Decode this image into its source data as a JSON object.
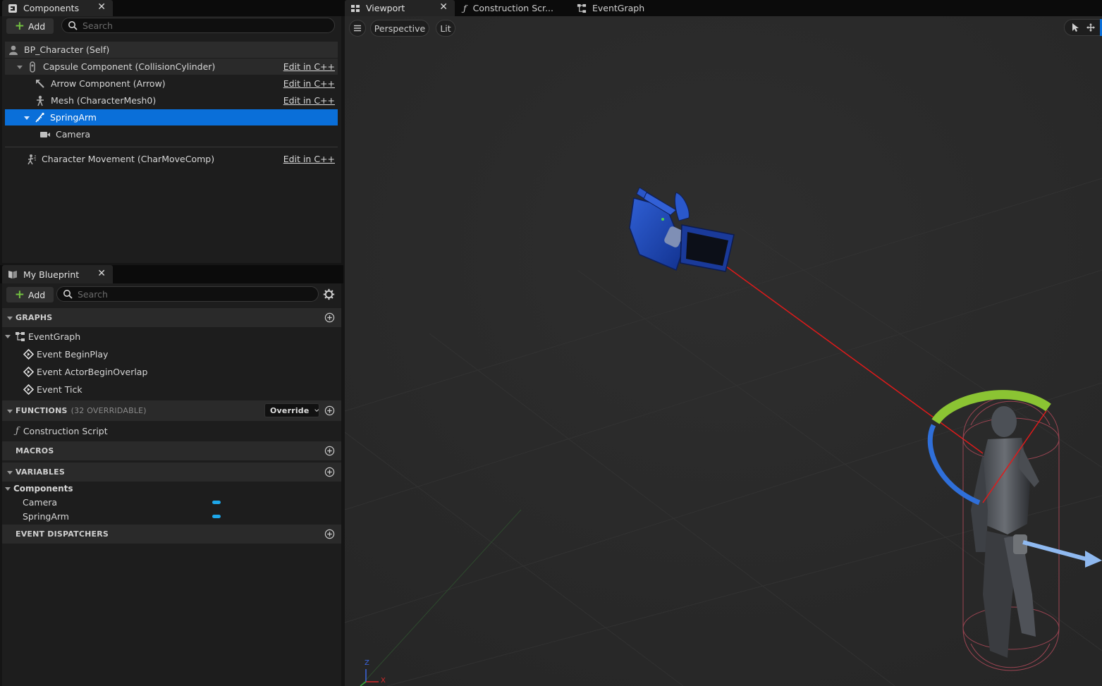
{
  "components_panel": {
    "tab_title": "Components",
    "add_label": "Add",
    "search_placeholder": "Search",
    "edit_cpp_label": "Edit in C++",
    "items": [
      {
        "label": "BP_Character (Self)"
      },
      {
        "label": "Capsule Component (CollisionCylinder)"
      },
      {
        "label": "Arrow Component (Arrow)"
      },
      {
        "label": "Mesh (CharacterMesh0)"
      },
      {
        "label": "SpringArm"
      },
      {
        "label": "Camera"
      },
      {
        "label": "Character Movement (CharMoveComp)"
      }
    ]
  },
  "my_blueprint": {
    "tab_title": "My Blueprint",
    "add_label": "Add",
    "search_placeholder": "Search",
    "graphs_header": "GRAPHS",
    "event_graph_label": "EventGraph",
    "events": [
      "Event BeginPlay",
      "Event ActorBeginOverlap",
      "Event Tick"
    ],
    "functions_header": "FUNCTIONS",
    "functions_overridable": "(32 OVERRIDABLE)",
    "override_label": "Override",
    "construction_script_label": "Construction Script",
    "macros_header": "MACROS",
    "variables_header": "VARIABLES",
    "variables_category": "Components",
    "variables": [
      "Camera",
      "SpringArm"
    ],
    "variable_color": "#1ea7ea",
    "event_dispatchers_header": "EVENT DISPATCHERS"
  },
  "editor_tabs": {
    "viewport": "Viewport",
    "construction_script": "Construction Scr...",
    "event_graph": "EventGraph"
  },
  "viewport": {
    "perspective_label": "Perspective",
    "lit_label": "Lit",
    "axis_z": "Z",
    "axis_x": "X"
  },
  "colors": {
    "selection": "#0a6fd9",
    "add_plus": "#72c141",
    "viewport_bg": "#2b2b2b"
  }
}
